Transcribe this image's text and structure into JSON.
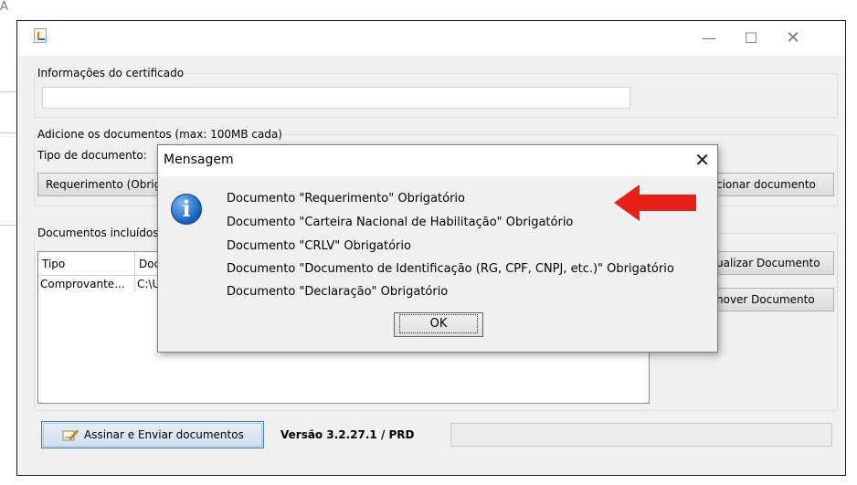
{
  "window": {
    "certificate_section_label": "Informações do certificado",
    "documents_section_label": "Adicione os  documentos (max: 100MB cada)",
    "document_type_label": "Tipo de documento:",
    "document_type_selected": "Requerimento (Obrig",
    "add_document_button": "cionar documento",
    "included_section_label": "Documentos incluídos",
    "table": {
      "columns": [
        "Tipo",
        "Doc"
      ],
      "rows": [
        {
          "tipo": "Comprovante...",
          "doc": "C:\\U"
        }
      ]
    },
    "view_document_button": "ualizar Documento",
    "remove_document_button": "nover Documento",
    "sign_send_button": "Assinar e Enviar documentos",
    "version_label": "Versão 3.2.27.1 / PRD"
  },
  "dialog": {
    "title": "Mensagem",
    "messages": [
      "Documento \"Requerimento\" Obrigatório",
      "Documento \"Carteira Nacional de Habilitação\" Obrigatório",
      "Documento \"CRLV\" Obrigatório",
      "Documento \"Documento de Identificação (RG, CPF, CNPJ, etc.)\" Obrigatório",
      "Documento \"Declaração\" Obrigatório"
    ],
    "ok_label": "OK"
  },
  "icons": {
    "info": "information-icon",
    "arrow": "red-arrow-annotation",
    "sign": "pen-sign-icon"
  },
  "colors": {
    "arrow": "#e8201a",
    "info_icon": "#1a64c4",
    "window_bg": "#f0f0f0"
  }
}
